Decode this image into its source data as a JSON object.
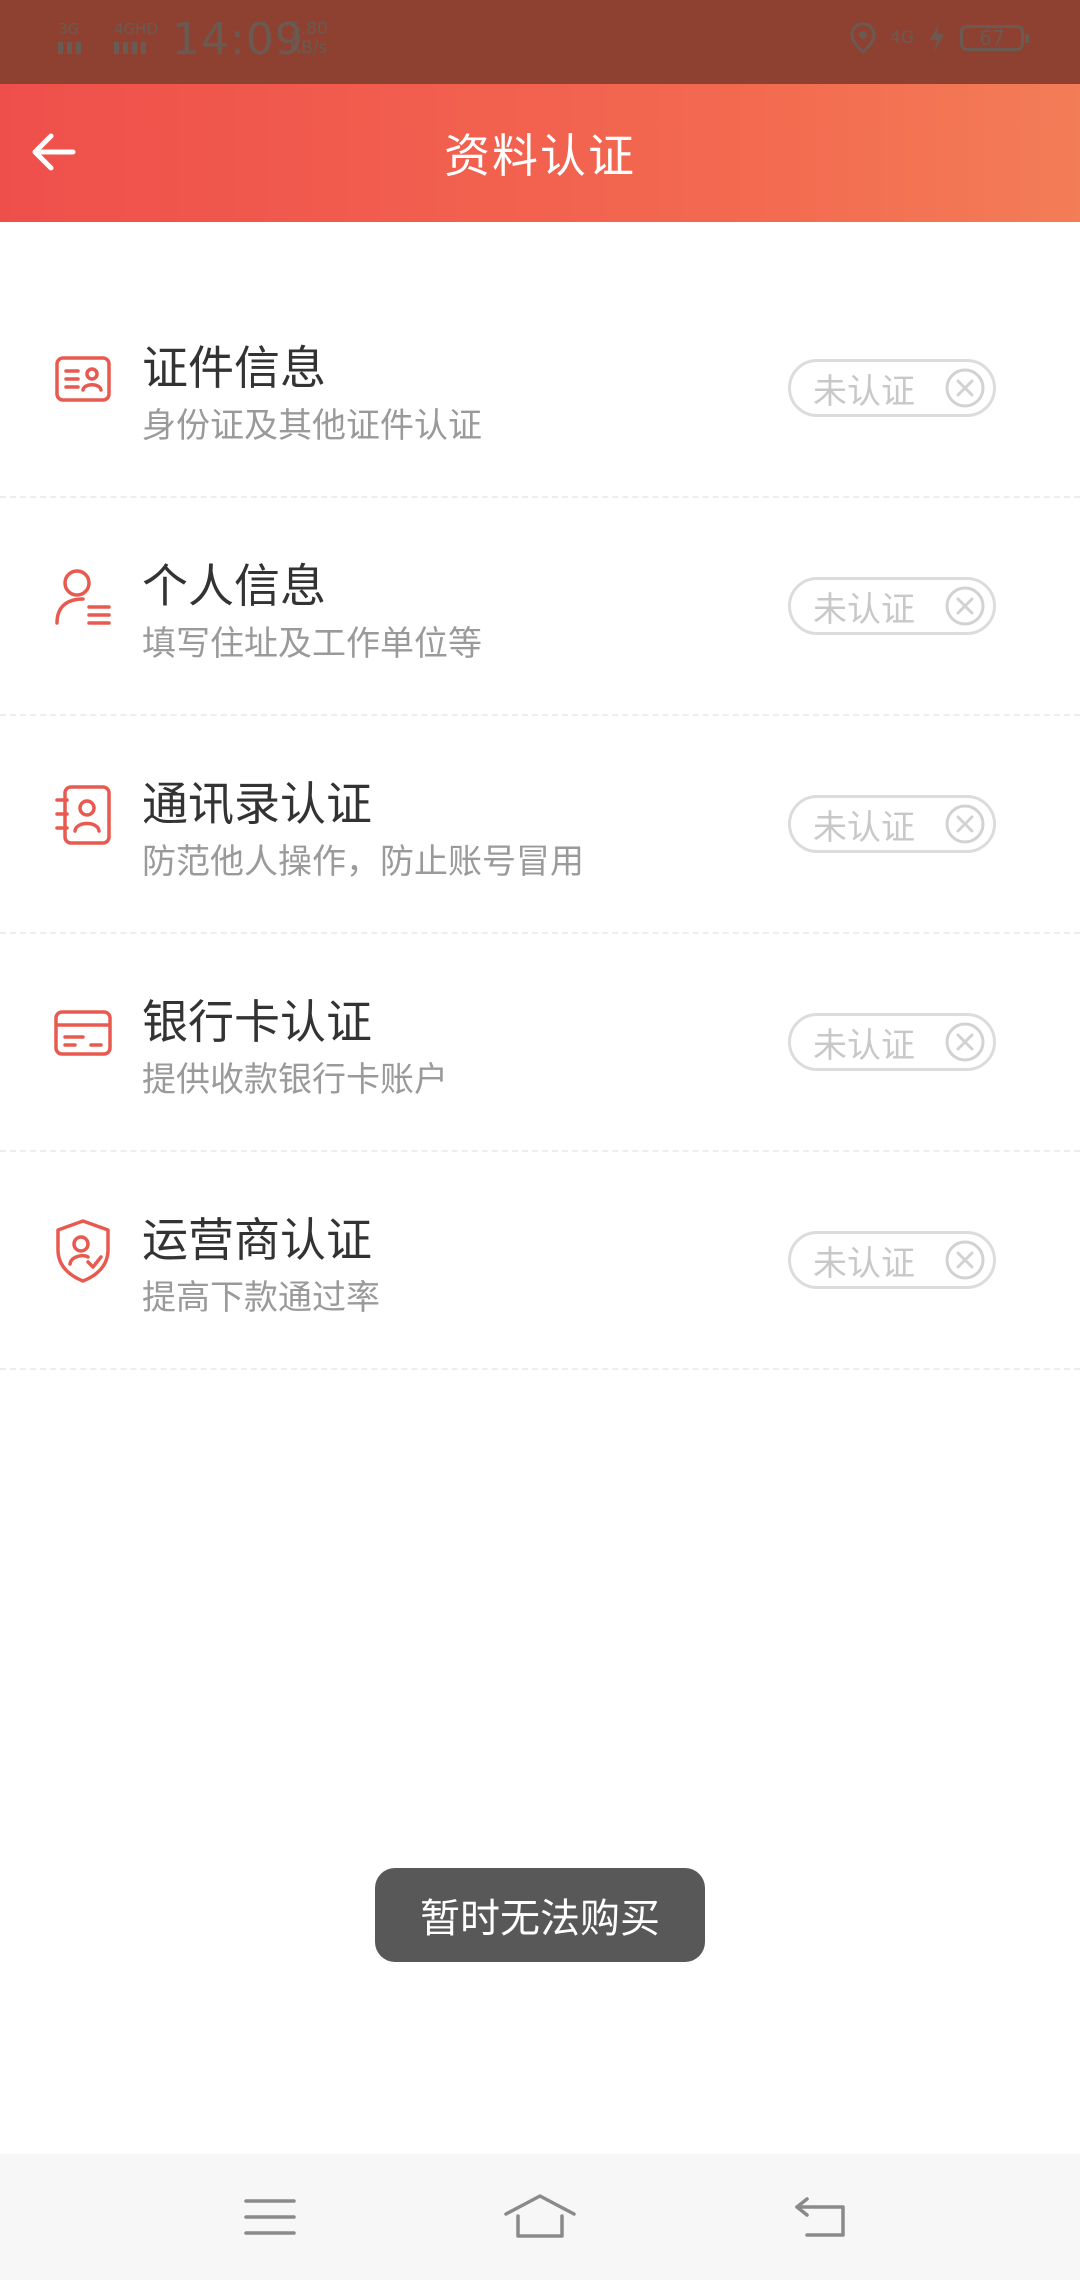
{
  "status_bar": {
    "net1": "3G",
    "net2": "4GHD",
    "time": "14:09",
    "speed_value": "5.80",
    "speed_unit": "KB/s",
    "net_right": "4G",
    "battery": "67"
  },
  "header": {
    "title": "资料认证"
  },
  "items": [
    {
      "title": "证件信息",
      "subtitle": "身份证及其他证件认证",
      "status": "未认证",
      "icon": "id-card-icon"
    },
    {
      "title": "个人信息",
      "subtitle": "填写住址及工作单位等",
      "status": "未认证",
      "icon": "person-icon"
    },
    {
      "title": "通讯录认证",
      "subtitle": "防范他人操作，防止账号冒用",
      "status": "未认证",
      "icon": "contacts-icon"
    },
    {
      "title": "银行卡认证",
      "subtitle": "提供收款银行卡账户",
      "status": "未认证",
      "icon": "bank-card-icon"
    },
    {
      "title": "运营商认证",
      "subtitle": "提高下款通过率",
      "status": "未认证",
      "icon": "shield-icon"
    }
  ],
  "toast": {
    "text": "暂时无法购买"
  },
  "colors": {
    "accent": "#ef4f4b",
    "accent_end": "#f37d57",
    "icon_red": "#e85a4f",
    "pill_border": "#dcdcdc",
    "pill_text": "#c8c8c8"
  }
}
